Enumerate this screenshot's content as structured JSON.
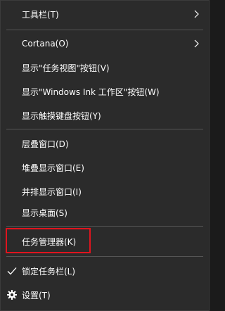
{
  "menu": {
    "items": [
      {
        "id": "toolbars",
        "label": "工具栏(T)",
        "has_submenu": true
      },
      {
        "id": "cortana",
        "label": "Cortana(O)",
        "has_submenu": true
      },
      {
        "id": "task-view",
        "label": "显示\"任务视图\"按钮(V)",
        "has_submenu": false
      },
      {
        "id": "windows-ink",
        "label": "显示\"Windows Ink 工作区\"按钮(W)",
        "has_submenu": false
      },
      {
        "id": "touch-keyboard",
        "label": "显示触摸键盘按钮(Y)",
        "has_submenu": false
      },
      {
        "id": "cascade",
        "label": "层叠窗口(D)",
        "has_submenu": false
      },
      {
        "id": "stacked",
        "label": "堆叠显示窗口(E)",
        "has_submenu": false
      },
      {
        "id": "side-by-side",
        "label": "并排显示窗口(I)",
        "has_submenu": false
      },
      {
        "id": "show-desktop",
        "label": "显示桌面(S)",
        "has_submenu": false
      },
      {
        "id": "task-manager",
        "label": "任务管理器(K)",
        "has_submenu": false,
        "highlighted": true
      },
      {
        "id": "lock-taskbar",
        "label": "锁定任务栏(L)",
        "has_submenu": false,
        "checked": true,
        "icon": "checkmark-icon"
      },
      {
        "id": "settings",
        "label": "设置(T)",
        "has_submenu": false,
        "icon": "gear-icon"
      }
    ]
  },
  "colors": {
    "background": "#2b2b2b",
    "text": "#ffffff",
    "separator": "#555555",
    "highlight_border": "#e0141e"
  }
}
